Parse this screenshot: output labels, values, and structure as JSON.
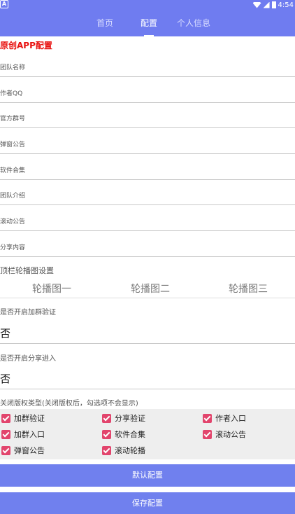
{
  "status_bar": {
    "time": "4:54",
    "left_badge": "A"
  },
  "nav": {
    "tabs": [
      {
        "label": "首页"
      },
      {
        "label": "配置"
      },
      {
        "label": "个人信息"
      }
    ]
  },
  "section_title": "原创APP配置",
  "fields": {
    "team_name": "团队名称",
    "author_qq": "作者QQ",
    "official_group": "官方群号",
    "popup_notice": "弹窗公告",
    "software_collection": "软件合集",
    "team_intro": "团队介绍",
    "scroll_notice": "滚动公告",
    "share_content": "分享内容"
  },
  "banner": {
    "title": "顶栏轮播图设置",
    "items": [
      "轮播图一",
      "轮播图二",
      "轮播图三"
    ]
  },
  "group_verify": {
    "label": "是否开启加群验证",
    "value": "否"
  },
  "share_entry": {
    "label": "是否开启分享进入",
    "value": "否"
  },
  "copyright": {
    "title": "关闭版权类型(关闭版权后，勾选项不会显示)",
    "options": [
      "加群验证",
      "分享验证",
      "作者入口",
      "加群入口",
      "软件合集",
      "滚动公告",
      "弹窗公告",
      "滚动轮播"
    ]
  },
  "buttons": {
    "default_config": "默认配置",
    "save_config": "保存配置"
  },
  "colors": {
    "accent": "#6f7cf0",
    "title_red": "#e8110f",
    "checkbox": "#e2446c"
  }
}
